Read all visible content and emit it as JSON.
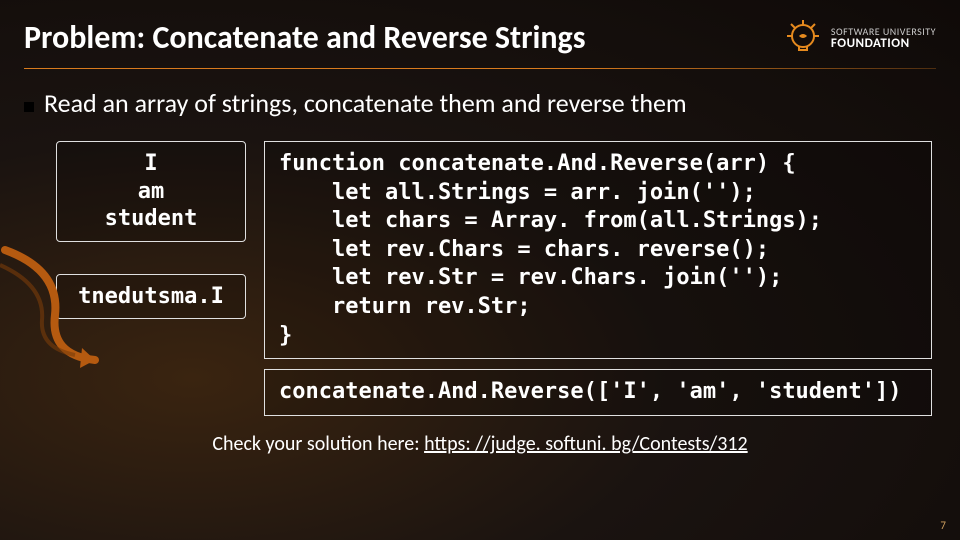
{
  "title": "Problem: Concatenate and Reverse Strings",
  "logo": {
    "line1": "SOFTWARE UNIVERSITY",
    "line2": "FOUNDATION"
  },
  "bullet": "Read an array of strings, concatenate them and reverse them",
  "example": {
    "input": "I\nam\nstudent",
    "output": "tnedutsma.I"
  },
  "code": "function concatenate.And.Reverse(arr) {\n    let all.Strings = arr. join('');\n    let chars = Array. from(all.Strings);\n    let rev.Chars = chars. reverse();\n    let rev.Str = rev.Chars. join('');\n    return rev.Str;\n}",
  "invocation": "concatenate.And.Reverse(['I', 'am', 'student'])",
  "footer": {
    "prefix": "Check your solution here: ",
    "link_text": "https: //judge. softuni. bg/Contests/312",
    "link_href": "https://judge.softuni.bg/Contests/312"
  },
  "page": "7"
}
